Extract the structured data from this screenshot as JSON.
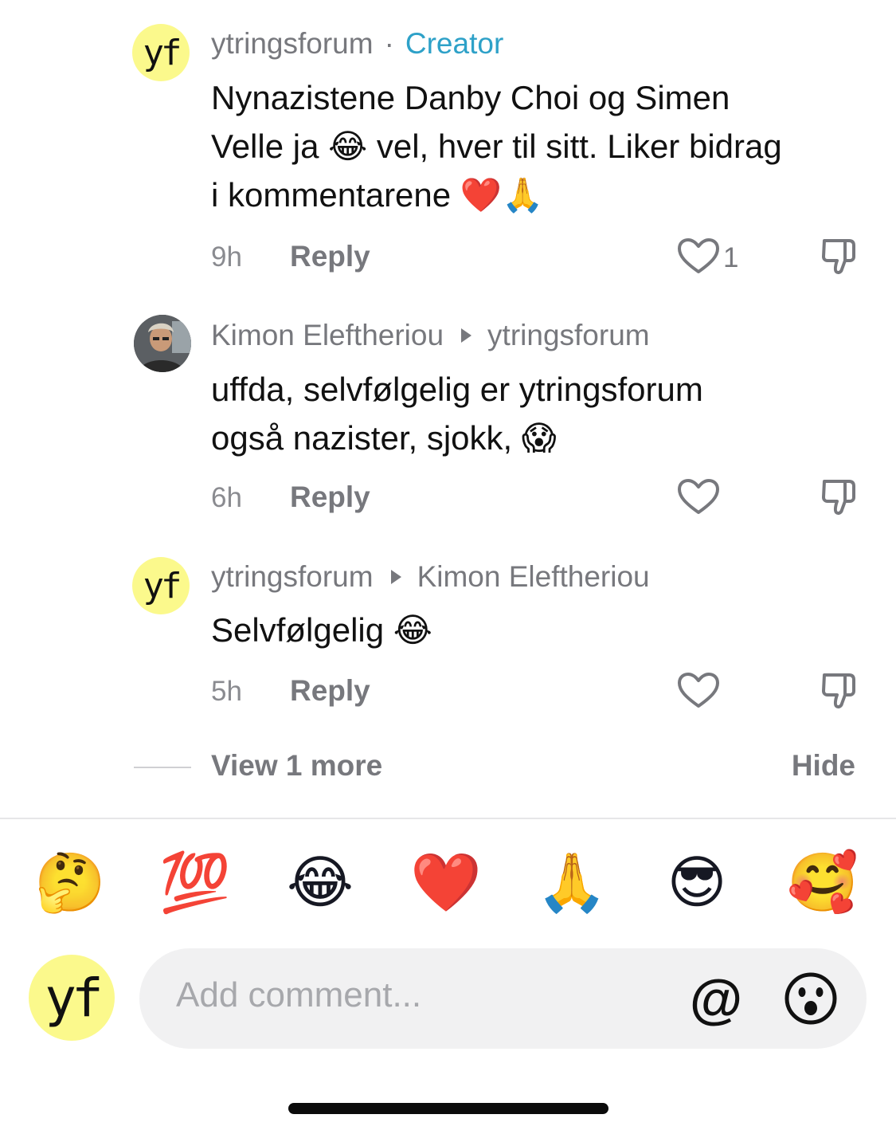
{
  "comments": [
    {
      "avatar_text": "yf",
      "username": "ytringsforum",
      "separator": "·",
      "badge": "Creator",
      "text_lines": [
        "Nynazistene Danby Choi og Simen",
        "Velle ja 😂 vel, hver til sitt. Liker bidrag",
        "i kommentarene ❤️🙏"
      ],
      "time": "9h",
      "reply_label": "Reply",
      "like_count": "1"
    },
    {
      "username": "Kimon Eleftheriou",
      "reply_to": "ytringsforum",
      "text_lines": [
        "uffda, selvfølgelig er ytringsforum",
        "også nazister, sjokk, 😱"
      ],
      "time": "6h",
      "reply_label": "Reply"
    },
    {
      "avatar_text": "yf",
      "username": "ytringsforum",
      "reply_to": "Kimon Eleftheriou",
      "text_lines": [
        "Selvfølgelig 😂"
      ],
      "time": "5h",
      "reply_label": "Reply"
    }
  ],
  "thread": {
    "view_more": "View 1 more",
    "hide": "Hide"
  },
  "emoji_bar": [
    "🤔",
    "💯",
    "😂",
    "❤️",
    "🙏",
    "😎",
    "🥰"
  ],
  "composer": {
    "avatar_text": "yf",
    "placeholder": "Add comment...",
    "at_symbol": "@"
  },
  "colors": {
    "creator": "#2ea1c8",
    "avatar_bg": "#fbf98c",
    "muted": "#77787d"
  }
}
